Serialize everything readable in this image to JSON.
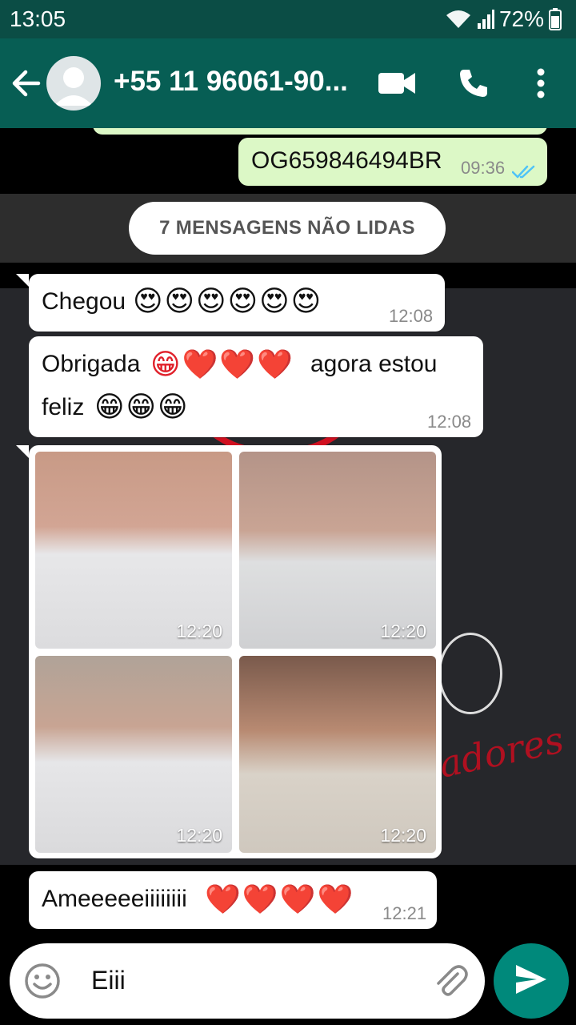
{
  "status_bar": {
    "time": "13:05",
    "battery": "72%"
  },
  "header": {
    "contact": "+55 11 96061-90..."
  },
  "messages": {
    "outgoing_code": {
      "text": "OG659846494BR",
      "time": "09:36"
    },
    "unread_banner": "7 MENSAGENS NÃO LIDAS",
    "msg1": {
      "text": "Chegou",
      "emoji": "😍😍😍😍😍😍",
      "time": "12:08"
    },
    "msg2": {
      "text_a": "Obrigada",
      "emoji_a": "😁❤️❤️❤️",
      "text_b": "agora estou",
      "text_c": "feliz",
      "emoji_b": "😁😁😁",
      "time": "12:08"
    },
    "photos": {
      "times": [
        "12:20",
        "12:20",
        "12:20",
        "12:20"
      ]
    },
    "msg3": {
      "text": "Ameeeeeiiiiiiii",
      "emoji": "❤️❤️❤️❤️",
      "time": "12:21"
    }
  },
  "wallpaper": {
    "text": "adores"
  },
  "input": {
    "value": "Eiii"
  },
  "colors": {
    "header": "#075e54",
    "status": "#0b4d45",
    "outgoing": "#dcf8c6",
    "send": "#00897b"
  }
}
